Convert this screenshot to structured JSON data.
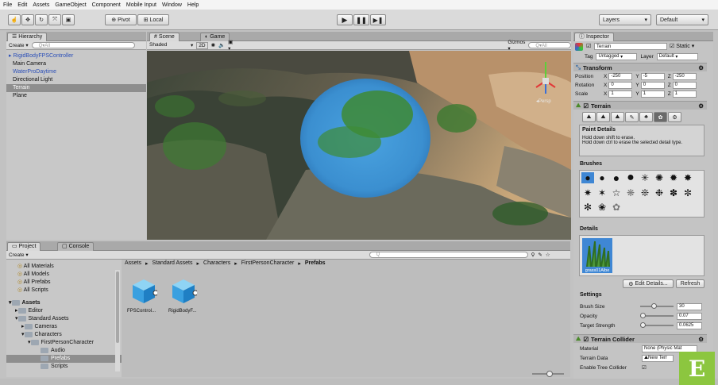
{
  "menu": [
    "File",
    "Edit",
    "Assets",
    "GameObject",
    "Component",
    "Mobile Input",
    "Window",
    "Help"
  ],
  "toolbar": {
    "pivot": "Pivot",
    "local": "Local",
    "layers": "Layers",
    "layout": "Default"
  },
  "hierarchy": {
    "tab": "Hierarchy",
    "create": "Create",
    "search_placeholder": "Q▾All",
    "items": [
      "RigidBodyFPSController",
      "Main Camera",
      "WaterProDaytime",
      "Directional Light",
      "Terrain",
      "Plane"
    ]
  },
  "scene": {
    "tab": "Scene",
    "shaded": "Shaded",
    "mode2d": "2D",
    "gizmos": "Gizmos",
    "search_placeholder": "Q▾All",
    "persp": "Persp"
  },
  "game": {
    "tab": "Game"
  },
  "project": {
    "tab": "Project",
    "console_tab": "Console",
    "create": "Create",
    "favorites": [
      "All Materials",
      "All Models",
      "All Prefabs",
      "All Scripts"
    ],
    "tree": {
      "assets": "Assets",
      "editor": "Editor",
      "standard_assets": "Standard Assets",
      "cameras": "Cameras",
      "characters": "Characters",
      "first_person": "FirstPersonCharacter",
      "audio": "Audio",
      "prefabs": "Prefabs",
      "scripts": "Scripts"
    },
    "breadcrumb": [
      "Assets",
      "Standard Assets",
      "Characters",
      "FirstPersonCharacter",
      "Prefabs"
    ],
    "assets": [
      "FPSControl...",
      "RigidBodyF..."
    ]
  },
  "inspector": {
    "tab": "Inspector",
    "object_name": "Terrain",
    "static_label": "Static",
    "tag_label": "Tag",
    "tag_value": "Untagged",
    "layer_label": "Layer",
    "layer_value": "Default",
    "transform": {
      "title": "Transform",
      "position_label": "Position",
      "rotation_label": "Rotation",
      "scale_label": "Scale",
      "position": [
        "-250",
        "-5",
        "-250"
      ],
      "rotation": [
        "0",
        "0",
        "0"
      ],
      "scale": [
        "1",
        "1",
        "1"
      ]
    },
    "terrain": {
      "title": "Terrain",
      "paint_details_title": "Paint Details",
      "paint_details_hint1": "Hold down shift to erase.",
      "paint_details_hint2": "Hold down ctrl to erase the selected detail type.",
      "brushes_label": "Brushes",
      "details_label": "Details",
      "detail_name": "grass01Albe",
      "edit_details": "Edit Details...",
      "refresh": "Refresh",
      "settings_label": "Settings",
      "brush_size_label": "Brush Size",
      "brush_size": "30",
      "opacity_label": "Opacity",
      "opacity": "0.07",
      "target_strength_label": "Target Strength",
      "target_strength": "0.0625"
    },
    "collider": {
      "title": "Terrain Collider",
      "material_label": "Material",
      "material_value": "None (Physic Mat",
      "terrain_data_label": "Terrain Data",
      "terrain_data_value": "New Terr",
      "enable_tree_label": "Enable Tree Collider"
    }
  },
  "badge": "E",
  "colors": {
    "accent": "#3f87d4",
    "badge": "#8cc63f",
    "selection": "#8e8e8e"
  }
}
